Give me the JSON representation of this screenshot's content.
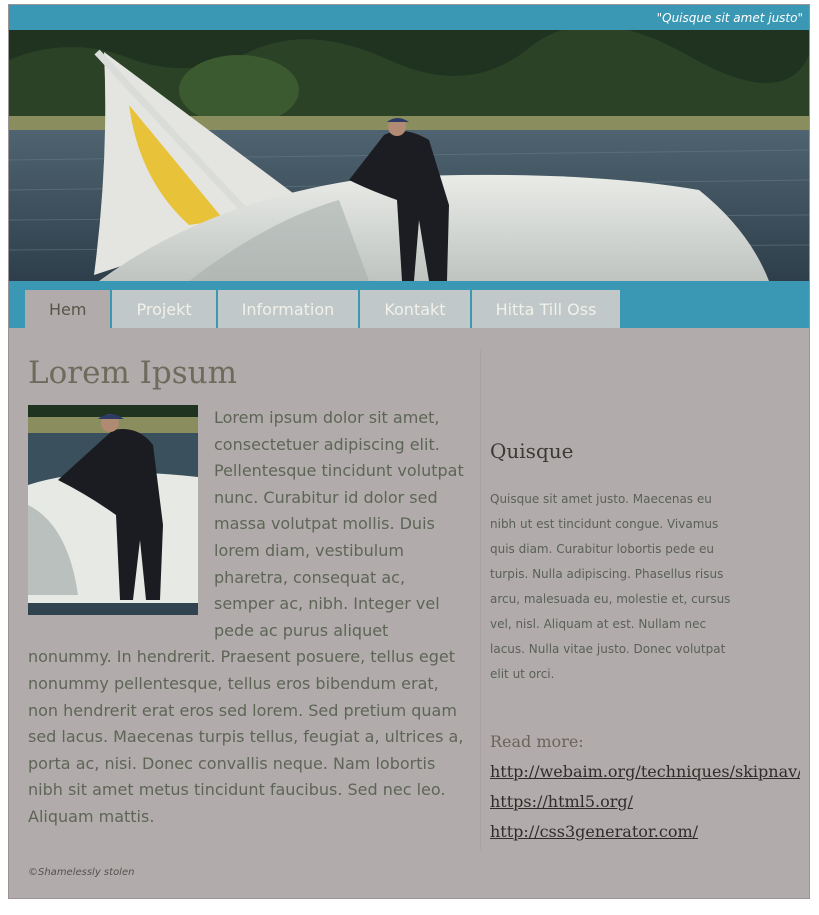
{
  "header": {
    "tagline": "\"Quisque sit amet justo\""
  },
  "nav": {
    "items": [
      {
        "label": "Hem",
        "active": true
      },
      {
        "label": "Projekt",
        "active": false
      },
      {
        "label": "Information",
        "active": false
      },
      {
        "label": "Kontakt",
        "active": false
      },
      {
        "label": "Hitta Till Oss",
        "active": false
      }
    ]
  },
  "main": {
    "title": "Lorem Ipsum",
    "body": "Lorem ipsum dolor sit amet, consectetuer adipiscing elit. Pellentesque tincidunt volutpat nunc. Curabitur id dolor sed massa volutpat mollis. Duis lorem diam, vestibulum pharetra, consequat ac, semper ac, nibh. Integer vel pede ac purus aliquet nonummy. In hendrerit. Praesent posuere, tellus eget nonummy pellentesque, tellus eros bibendum erat, non hendrerit erat eros sed lorem. Sed pretium quam sed lacus. Maecenas turpis tellus, feugiat a, ultrices a, porta ac, nisi. Donec convallis neque. Nam lobortis nibh sit amet metus tincidunt faucibus. Sed nec leo. Aliquam mattis."
  },
  "aside": {
    "title": "Quisque",
    "text": "Quisque sit amet justo. Maecenas eu nibh ut est tincidunt congue. Vivamus quis diam. Curabitur lobortis pede eu turpis. Nulla adipiscing. Phasellus risus arcu, malesuada eu, molestie et, cursus vel, nisl. Aliquam at est. Nullam nec lacus. Nulla vitae justo. Donec volutpat elit ut orci.",
    "readmore_label": "Read more:",
    "links": [
      "http://webaim.org/techniques/skipnav/",
      "https://html5.org/",
      "http://css3generator.com/"
    ]
  },
  "footer": {
    "text": "©Shamelessly stolen"
  },
  "colors": {
    "accent": "#3b98b4",
    "page_background": "#b1acab",
    "tab_inactive": "#c0c8c9"
  }
}
